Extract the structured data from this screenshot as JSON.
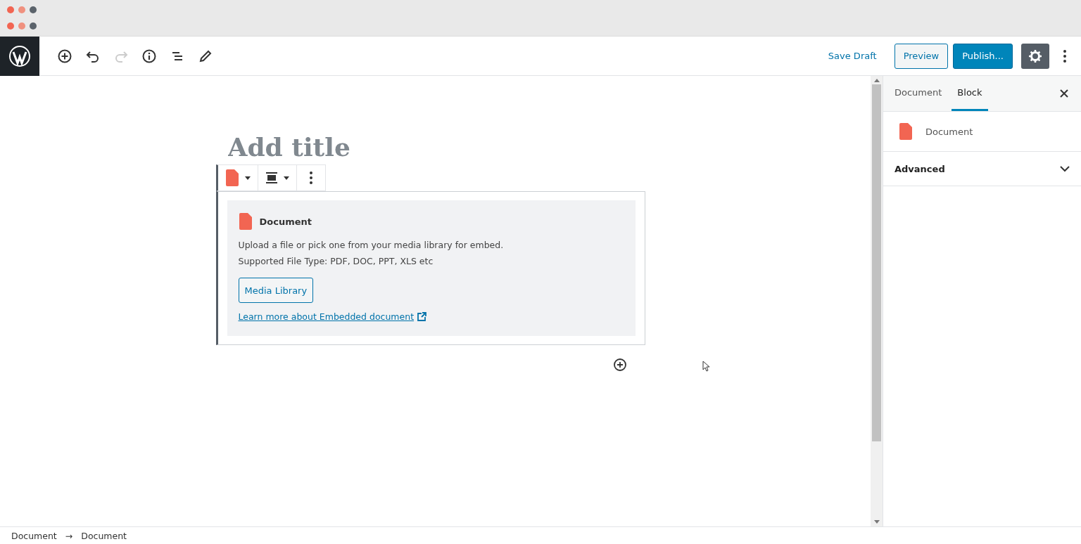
{
  "header": {
    "save_draft": "Save Draft",
    "preview": "Preview",
    "publish": "Publish..."
  },
  "editor": {
    "title_placeholder": "Add title",
    "block": {
      "name": "Document",
      "description": "Upload a file or pick one from your media library for embed.",
      "file_types": "Supported File Type: PDF, DOC, PPT, XLS etc",
      "button": "Media Library",
      "link": "Learn more about Embedded document"
    }
  },
  "sidebar": {
    "tabs": [
      {
        "label": "Document",
        "selected": false
      },
      {
        "label": "Block",
        "selected": true
      }
    ],
    "block_name": "Document",
    "panels": [
      {
        "label": "Advanced",
        "expanded": false
      }
    ]
  },
  "breadcrumb": {
    "items": [
      "Document",
      "Document"
    ],
    "separator": "→"
  }
}
